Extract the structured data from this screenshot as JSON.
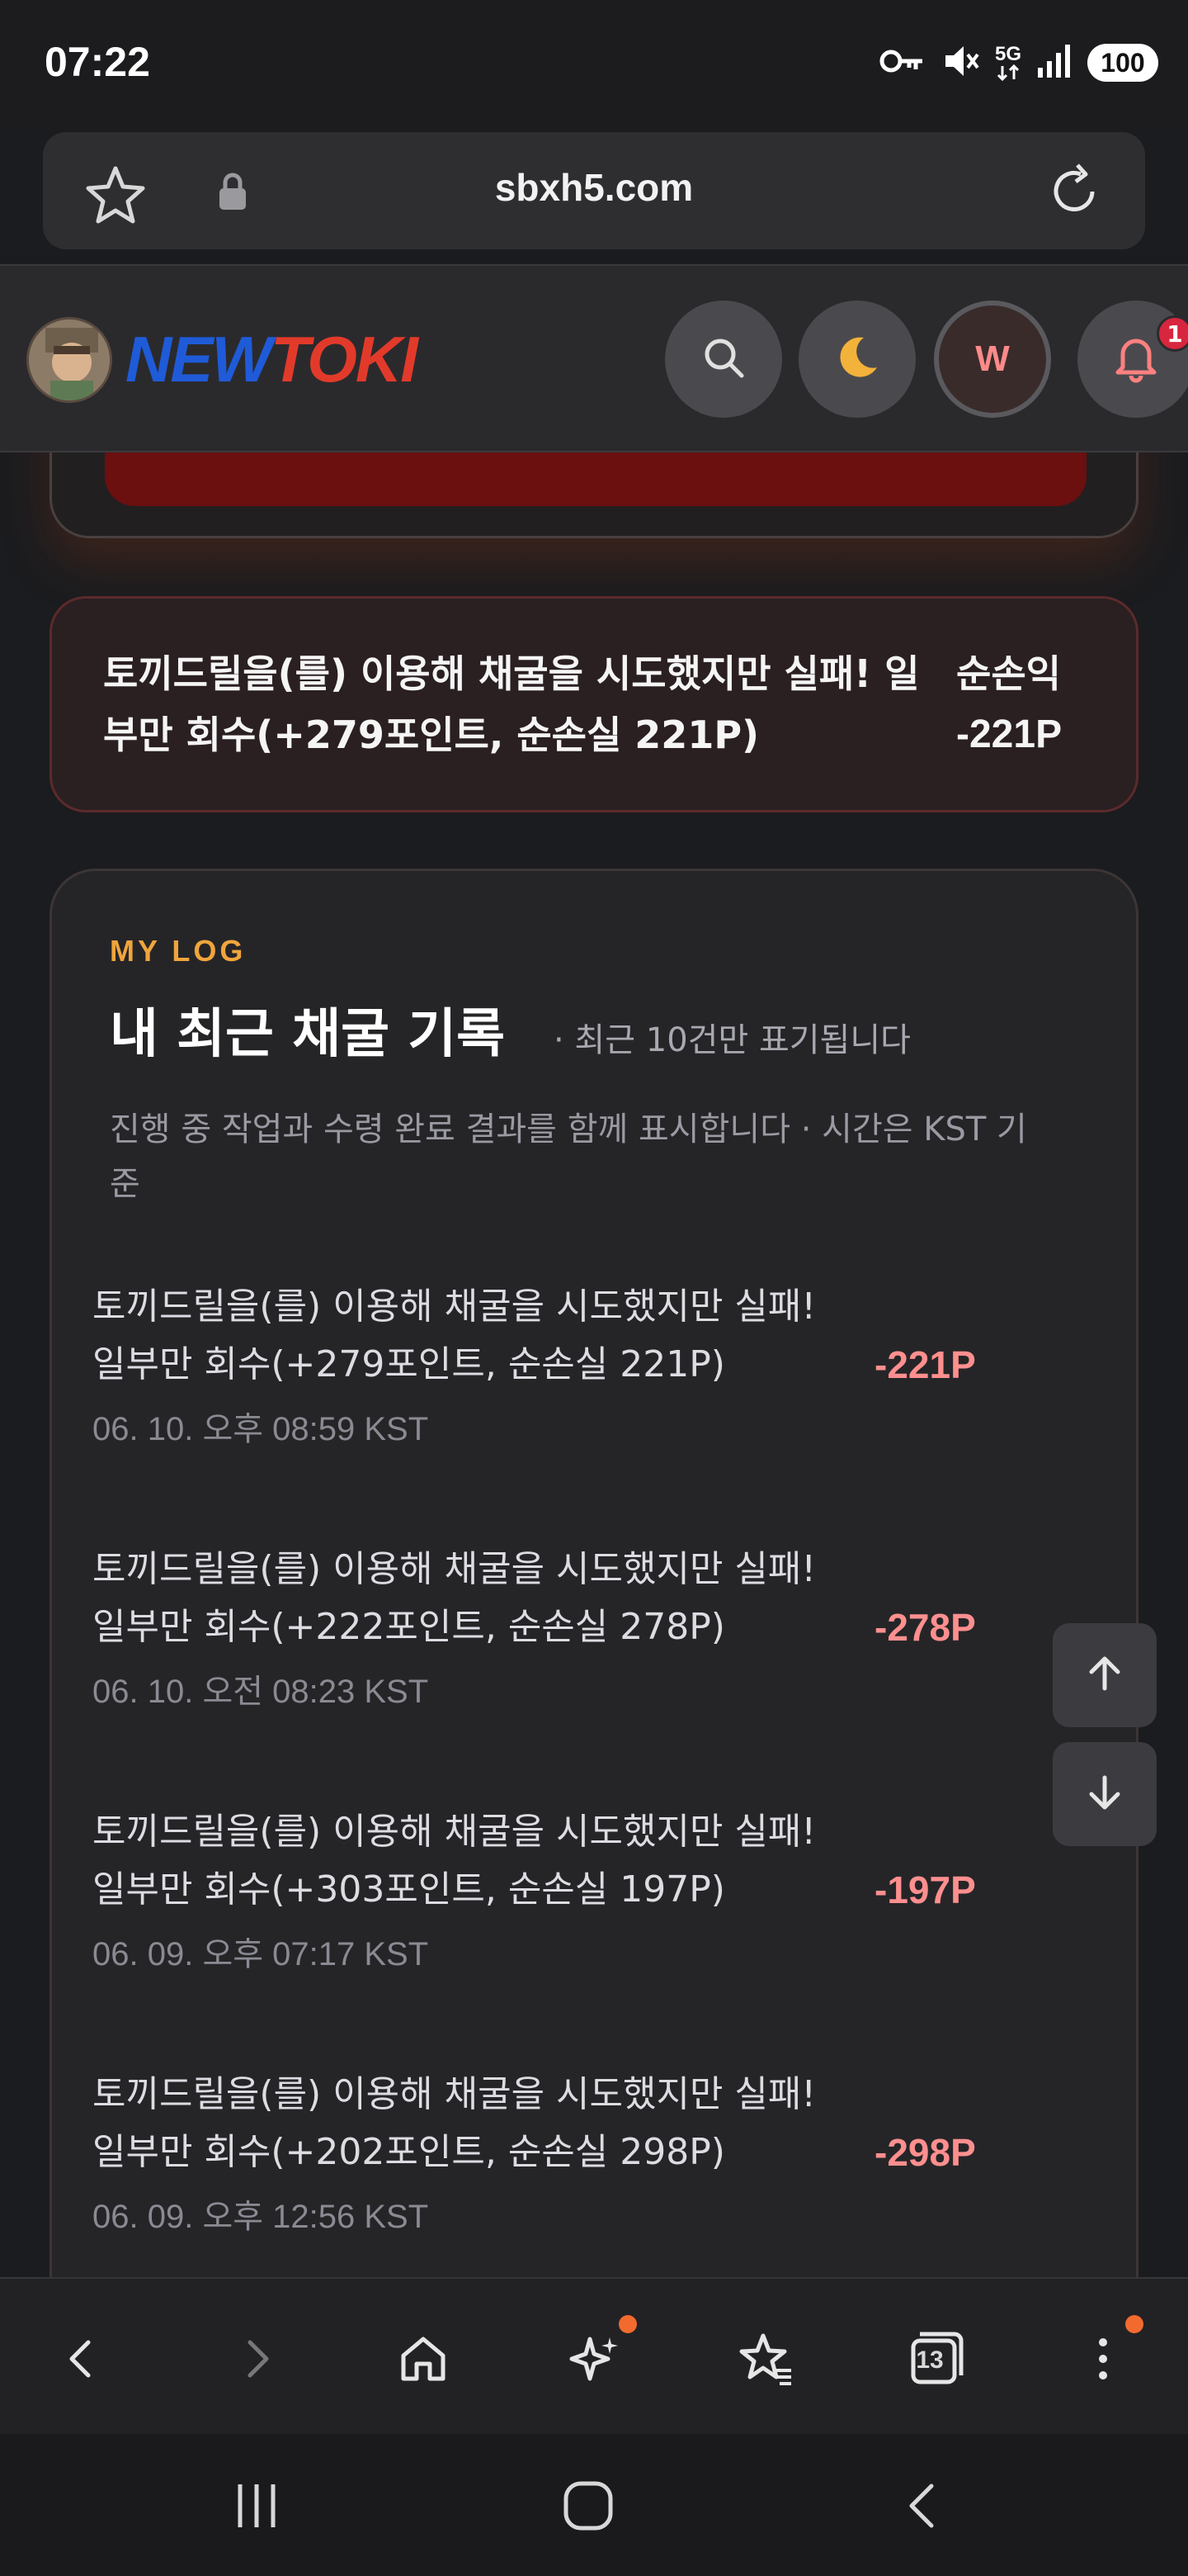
{
  "status_bar": {
    "time": "07:22",
    "network": "5G",
    "battery": "100",
    "icons": [
      "key-icon",
      "mute-icon",
      "5g-icon",
      "signal-icon",
      "battery-icon"
    ]
  },
  "browser": {
    "url": "sbxh5.com",
    "icons": [
      "star-icon",
      "lock-icon",
      "reload-icon"
    ]
  },
  "site_header": {
    "logo_part1": "NEW",
    "logo_part2": "TOKI",
    "user_initial": "W",
    "notification_count": "1",
    "icons": [
      "avatar",
      "search-icon",
      "moon-icon",
      "user-icon",
      "bell-icon"
    ]
  },
  "alert": {
    "message": "토끼드릴을(를) 이용해 채굴을 시도했지만 실패! 일부만 회수(+279포인트, 순손실 221P)",
    "label": "순손익",
    "amount": "-221P"
  },
  "log": {
    "eyebrow": "MY LOG",
    "title": "내 최근 채굴 기록",
    "subtitle": "· 최근 10건만 표기됩니다",
    "description": "진행 중 작업과 수령 완료 결과를 함께 표시합니다 · 시간은 KST 기준",
    "entries": [
      {
        "message": "토끼드릴을(를) 이용해 채굴을 시도했지만 실패! 일부만 회수(+279포인트, 순손실 221P)",
        "time": "06. 10. 오후 08:59 KST",
        "amount": "-221P"
      },
      {
        "message": "토끼드릴을(를) 이용해 채굴을 시도했지만 실패! 일부만 회수(+222포인트, 순손실 278P)",
        "time": "06. 10. 오전 08:23 KST",
        "amount": "-278P"
      },
      {
        "message": "토끼드릴을(를) 이용해 채굴을 시도했지만 실패! 일부만 회수(+303포인트, 순손실 197P)",
        "time": "06. 09. 오후 07:17 KST",
        "amount": "-197P"
      },
      {
        "message": "토끼드릴을(를) 이용해 채굴을 시도했지만 실패! 일부만 회수(+202포인트, 순손실 298P)",
        "time": "06. 09. 오후 12:56 KST",
        "amount": "-298P"
      }
    ]
  },
  "floating": {
    "icons": [
      "arrow-up-icon",
      "arrow-down-icon"
    ]
  },
  "bottom_bar": {
    "tab_count": "13",
    "icons": [
      "back-icon",
      "forward-icon",
      "home-icon",
      "sparkle-icon",
      "bookmarks-icon",
      "tabs-icon",
      "menu-icon"
    ]
  },
  "system_nav": {
    "icons": [
      "recents-icon",
      "home-circle-icon",
      "system-back-icon"
    ]
  },
  "colors": {
    "accent_orange": "#f0a53c",
    "loss_red": "#ff8f8f",
    "logo_blue": "#1f5bd8",
    "logo_red": "#e23a2a",
    "badge_red": "#d7263d"
  }
}
